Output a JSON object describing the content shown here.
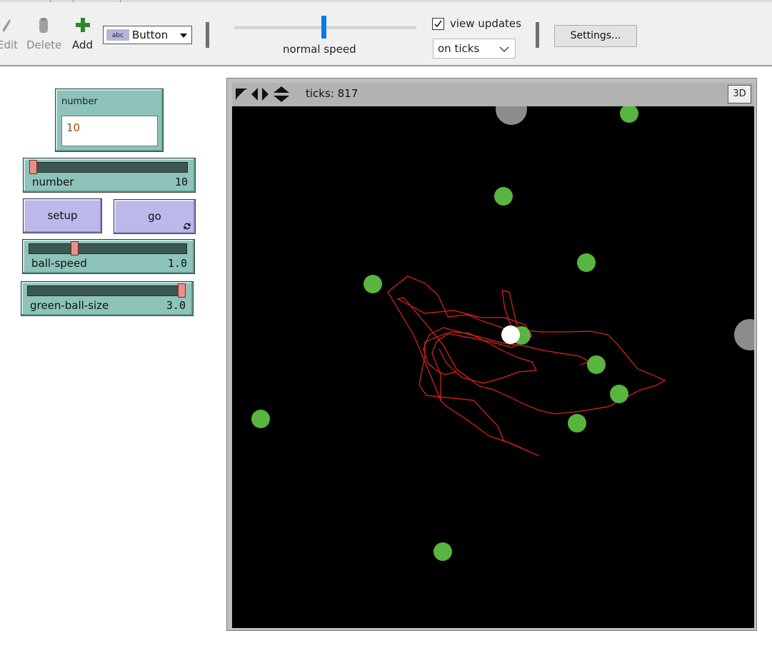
{
  "toolbar": {
    "edit_label": "Edit",
    "delete_label": "Delete",
    "add_label": "Add",
    "widget_type": "Button",
    "speed_label": "normal speed",
    "speed_fraction": 0.49,
    "view_updates_label": "view updates",
    "view_updates_checked": true,
    "update_mode": "on ticks",
    "settings_label": "Settings..."
  },
  "interface": {
    "input": {
      "label": "number",
      "value": "10"
    },
    "sliders": [
      {
        "name": "number",
        "value": "10",
        "fraction": 0.0
      },
      {
        "name": "ball-speed",
        "value": "1.0",
        "fraction": 0.28
      },
      {
        "name": "green-ball-size",
        "value": "3.0",
        "fraction": 1.0
      }
    ],
    "buttons": [
      {
        "label": "setup",
        "forever": false
      },
      {
        "label": "go",
        "forever": true
      }
    ]
  },
  "view": {
    "ticks_label": "ticks: 817",
    "three_d_label": "3D"
  },
  "colors": {
    "widget_teal": "#8dc3b9",
    "button_lavender": "#bcb8ea",
    "green_ball": "#58b53f",
    "trail_red": "#e2251b",
    "gray_ball": "#8c8c8c",
    "white_ball": "#ffffff",
    "speed_thumb": "#0a7ae6"
  },
  "icons": [
    "pencil-icon",
    "trash-icon",
    "plus-icon",
    "forever-icon",
    "shapes-icon",
    "arrows-horizontal-icon",
    "arrows-vertical-icon",
    "chevron-down-icon",
    "check-icon"
  ]
}
